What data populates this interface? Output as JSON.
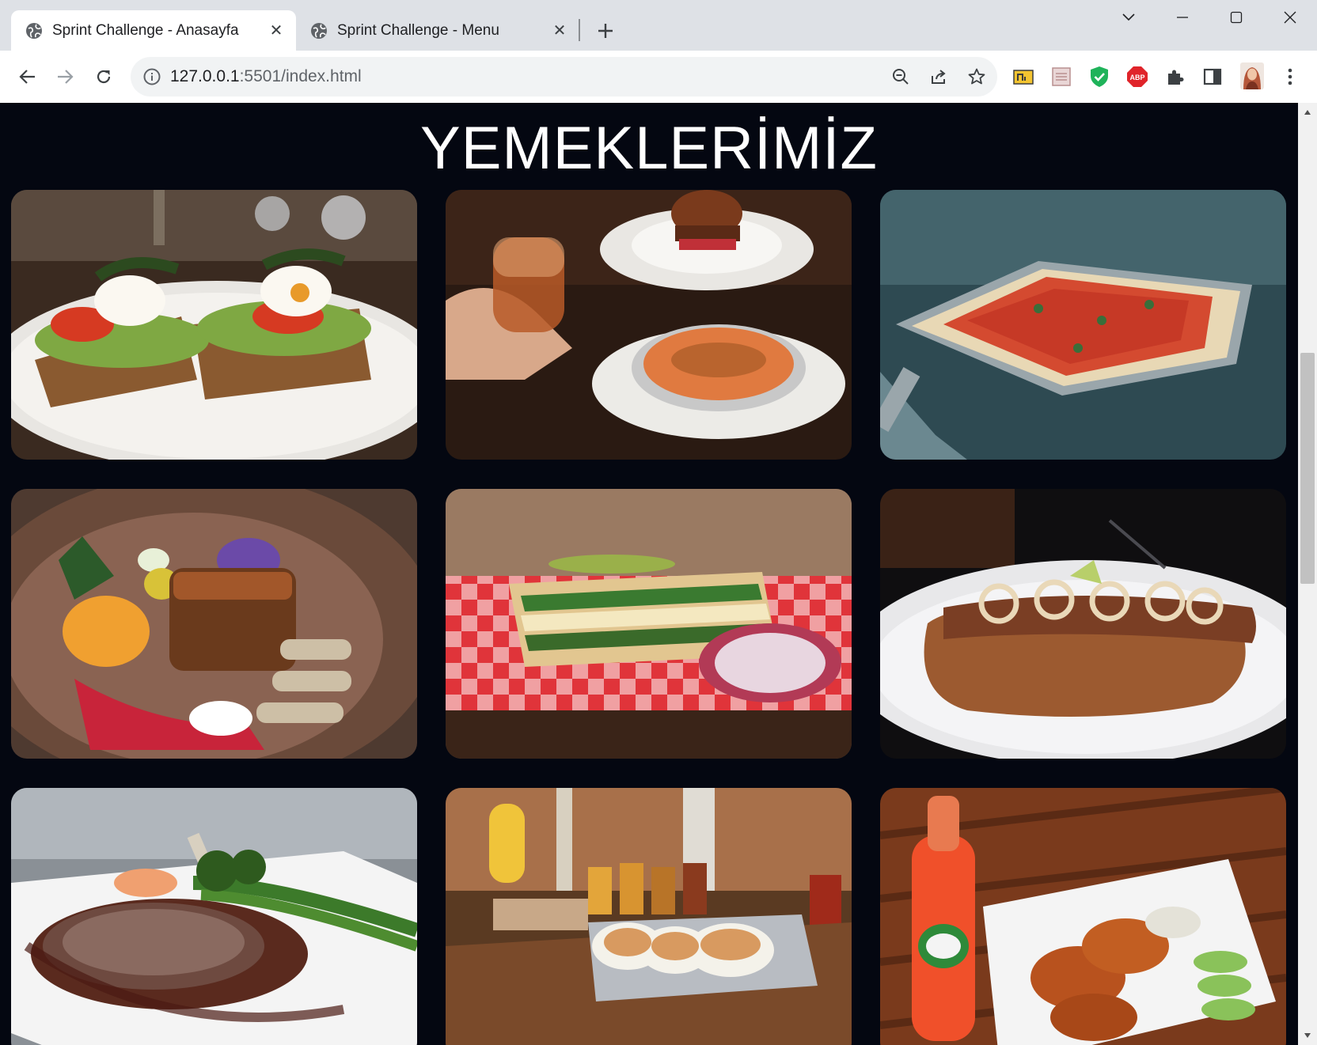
{
  "browser": {
    "tabs": [
      {
        "title": "Sprint Challenge - Anasayfa",
        "active": true
      },
      {
        "title": "Sprint Challenge - Menu",
        "active": false
      }
    ],
    "address": {
      "host": "127.0.0.1",
      "path": ":5501/index.html"
    },
    "extensions": [
      "note-extension-icon",
      "extension-frame-icon",
      "shield-check-icon",
      "adblock-plus-icon",
      "puzzle-icon",
      "side-panel-icon",
      "profile-avatar"
    ]
  },
  "page": {
    "title": "YEMEKLERİMİZ",
    "background": "#040711",
    "dishes": [
      {
        "name": "avocado-toast-poached-egg"
      },
      {
        "name": "burger-and-mac-cheese"
      },
      {
        "name": "loaded-fries-skillet"
      },
      {
        "name": "braised-short-rib"
      },
      {
        "name": "club-sandwich-checkered-cloth"
      },
      {
        "name": "sausage-in-bun"
      },
      {
        "name": "steak-with-broccolini"
      },
      {
        "name": "fish-tacos-and-beer-flight"
      },
      {
        "name": "chicken-wings-and-soda"
      }
    ]
  }
}
